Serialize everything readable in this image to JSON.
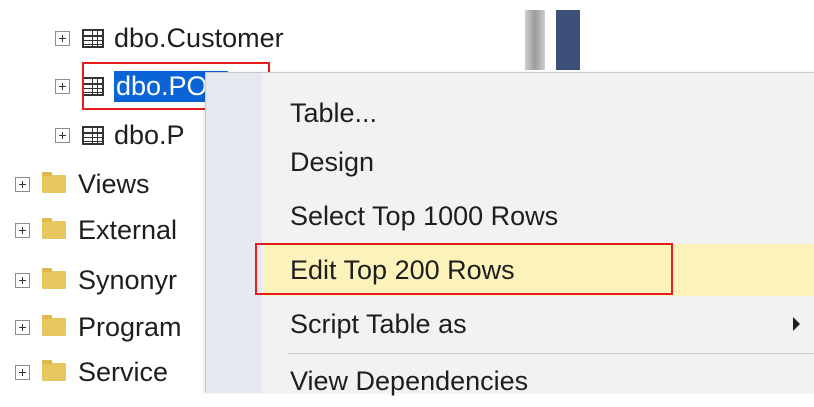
{
  "tree": {
    "tables": [
      {
        "label": "dbo.Customer",
        "selected": false
      },
      {
        "label": "dbo.POS",
        "selected": true
      },
      {
        "label": "dbo.P",
        "selected": false
      }
    ],
    "folders": [
      {
        "label": "Views"
      },
      {
        "label": "External"
      },
      {
        "label": "Synonyr"
      },
      {
        "label": "Program"
      },
      {
        "label": "Service"
      }
    ]
  },
  "context_menu": {
    "items": [
      {
        "label": "Table...",
        "highlighted": false
      },
      {
        "label": "Design",
        "highlighted": false
      },
      {
        "label": "Select Top 1000 Rows",
        "highlighted": false
      },
      {
        "label": "Edit Top 200 Rows",
        "highlighted": true
      },
      {
        "label": "Script Table as",
        "has_submenu": true
      }
    ],
    "partial_item": "View Dependencies"
  },
  "colors": {
    "selection": "#0a64d6",
    "menu_highlight": "#fcf3bb",
    "annotation_box": "#e31d1d",
    "folder": "#e8c660"
  },
  "icons": [
    "expand-icon",
    "table-icon",
    "folder-icon",
    "submenu-arrow-icon"
  ]
}
